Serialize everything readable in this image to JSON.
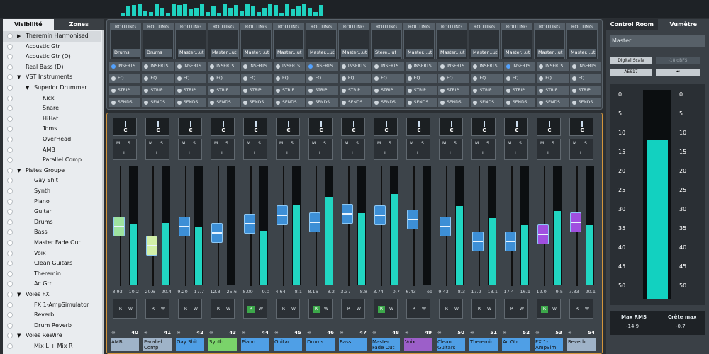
{
  "left_panel": {
    "tabs": [
      "Visibilité",
      "Zones"
    ],
    "tree": [
      {
        "label": "Theremin Harmonised",
        "level": 0,
        "expand": "right",
        "selected": true
      },
      {
        "label": "Acoustic Gtr",
        "level": 0
      },
      {
        "label": "Acoustic Gtr (D)",
        "level": 0
      },
      {
        "label": "Real Bass (D)",
        "level": 0
      },
      {
        "label": "VST Instruments",
        "level": 0,
        "expand": "down"
      },
      {
        "label": "Superior Drummer",
        "level": 1,
        "expand": "down"
      },
      {
        "label": "Kick",
        "level": 2
      },
      {
        "label": "Snare",
        "level": 2
      },
      {
        "label": "HiHat",
        "level": 2
      },
      {
        "label": "Toms",
        "level": 2
      },
      {
        "label": "OverHead",
        "level": 2
      },
      {
        "label": "AMB",
        "level": 2
      },
      {
        "label": "Parallel Comp",
        "level": 2
      },
      {
        "label": "Pistes Groupe",
        "level": 0,
        "expand": "down"
      },
      {
        "label": "Gay Shit",
        "level": 1
      },
      {
        "label": "Synth",
        "level": 1
      },
      {
        "label": "Piano",
        "level": 1
      },
      {
        "label": "Guitar",
        "level": 1
      },
      {
        "label": "Drums",
        "level": 1
      },
      {
        "label": "Bass",
        "level": 1
      },
      {
        "label": "Master Fade Out",
        "level": 1
      },
      {
        "label": "Voix",
        "level": 1
      },
      {
        "label": "Clean Guitars",
        "level": 1
      },
      {
        "label": "Theremin",
        "level": 1
      },
      {
        "label": "Ac Gtr",
        "level": 1
      },
      {
        "label": "Voies FX",
        "level": 0,
        "expand": "down"
      },
      {
        "label": "FX 1-AmpSimulator",
        "level": 1
      },
      {
        "label": "Reverb",
        "level": 1
      },
      {
        "label": "Drum Reverb",
        "level": 1
      },
      {
        "label": "Voies ReWire",
        "level": 0,
        "expand": "down"
      },
      {
        "label": "Mix L + Mix R",
        "level": 1
      }
    ]
  },
  "routing": {
    "header": "ROUTING",
    "outputs": [
      "Drums",
      "Drums",
      "Master...ut",
      "Master...ut",
      "Master...ut",
      "Master...ut",
      "Master...ut",
      "Master...ut",
      "Stere...ut",
      "Master...ut",
      "Master...ut",
      "Master...ut",
      "Master...ut",
      "Master...ut",
      "Master...ut"
    ],
    "section_labels": [
      "INSERTS",
      "EQ",
      "STRIP",
      "SENDS"
    ],
    "active_mask": {
      "INSERTS": [
        1,
        0,
        0,
        0,
        0,
        0,
        1,
        0,
        0,
        0,
        0,
        0,
        1,
        0,
        0
      ],
      "EQ": [
        0,
        0,
        0,
        0,
        0,
        0,
        0,
        0,
        0,
        0,
        0,
        0,
        0,
        0,
        0
      ],
      "STRIP": [
        0,
        0,
        0,
        0,
        0,
        0,
        0,
        0,
        0,
        0,
        0,
        0,
        0,
        0,
        0
      ],
      "SENDS": [
        0,
        0,
        0,
        0,
        0,
        0,
        0,
        0,
        0,
        0,
        0,
        0,
        0,
        0,
        0
      ]
    }
  },
  "channels": [
    {
      "num": "40",
      "name": "AMB",
      "color": "#9fb3c8",
      "fader_db": "-8.93",
      "meter_db": "-10.2",
      "fader": 0.52,
      "meter": 0.51,
      "cap": "#9ee3a0",
      "rw": "none"
    },
    {
      "num": "41",
      "name": "Parallel Comp",
      "color": "#9fb3c8",
      "fader_db": "-20.6",
      "meter_db": "-20.4",
      "fader": 0.34,
      "meter": 0.52,
      "cap": "#d2f0a8",
      "rw": "none"
    },
    {
      "num": "42",
      "name": "Gay Shit",
      "color": "#4f9fe6",
      "fader_db": "-9.20",
      "meter_db": "-17.7",
      "fader": 0.52,
      "meter": 0.48,
      "cap": "#3d8fd6",
      "rw": "none"
    },
    {
      "num": "43",
      "name": "Synth",
      "color": "#7ad36a",
      "fader_db": "-12.3",
      "meter_db": "-25.6",
      "fader": 0.46,
      "meter": 0.0,
      "cap": "#3d8fd6",
      "rw": "none"
    },
    {
      "num": "44",
      "name": "Piano",
      "color": "#4f9fe6",
      "fader_db": "-8.00",
      "meter_db": "-9.0",
      "fader": 0.55,
      "meter": 0.45,
      "cap": "#3d8fd6",
      "rw": "on"
    },
    {
      "num": "45",
      "name": "Guitar",
      "color": "#4f9fe6",
      "fader_db": "-4.64",
      "meter_db": "-8.1",
      "fader": 0.63,
      "meter": 0.67,
      "cap": "#3d8fd6",
      "rw": "none"
    },
    {
      "num": "46",
      "name": "Drums",
      "color": "#4f9fe6",
      "fader_db": "-8.16",
      "meter_db": "-8.2",
      "fader": 0.56,
      "meter": 0.74,
      "cap": "#3d8fd6",
      "rw": "on"
    },
    {
      "num": "47",
      "name": "Bass",
      "color": "#4f9fe6",
      "fader_db": "-3.37",
      "meter_db": "-8.8",
      "fader": 0.64,
      "meter": 0.6,
      "cap": "#3d8fd6",
      "rw": "none"
    },
    {
      "num": "48",
      "name": "Master Fade Out",
      "color": "#4f9fe6",
      "fader_db": "-3.74",
      "meter_db": "-0.7",
      "fader": 0.63,
      "meter": 0.76,
      "cap": "#3d8fd6",
      "rw": "on"
    },
    {
      "num": "49",
      "name": "Voix",
      "color": "#9c5fc9",
      "fader_db": "-6.43",
      "meter_db": "-oo",
      "fader": 0.59,
      "meter": 0.0,
      "cap": "#3d8fd6",
      "rw": "none"
    },
    {
      "num": "50",
      "name": "Clean Guitars",
      "color": "#4f9fe6",
      "fader_db": "-9.43",
      "meter_db": "-8.3",
      "fader": 0.52,
      "meter": 0.66,
      "cap": "#3d8fd6",
      "rw": "none"
    },
    {
      "num": "51",
      "name": "Theremin",
      "color": "#4f9fe6",
      "fader_db": "-17.9",
      "meter_db": "-13.1",
      "fader": 0.38,
      "meter": 0.56,
      "cap": "#3d8fd6",
      "rw": "none"
    },
    {
      "num": "52",
      "name": "Ac Gtr",
      "color": "#4f9fe6",
      "fader_db": "-17.4",
      "meter_db": "-16.1",
      "fader": 0.38,
      "meter": 0.5,
      "cap": "#3d8fd6",
      "rw": "none"
    },
    {
      "num": "53",
      "name": "FX 1-AmpSim",
      "color": "#4f9fe6",
      "fader_db": "-12.0",
      "meter_db": "-9.5",
      "fader": 0.45,
      "meter": 0.62,
      "cap": "#a04fe0",
      "rw": "on"
    },
    {
      "num": "54",
      "name": "Reverb",
      "color": "#9fb3c8",
      "fader_db": "-7.33",
      "meter_db": "-20.1",
      "fader": 0.56,
      "meter": 0.5,
      "cap": "#a04fe0",
      "rw": "none"
    }
  ],
  "right_panel": {
    "tabs": [
      "Control Room",
      "Vumètre"
    ],
    "master_label": "Master",
    "digital_scale": "Digital Scale",
    "dbfs": "-18 dBFS",
    "aes": "AES17",
    "reset_symbol": "⏮",
    "scale": [
      "0",
      "5",
      "10",
      "15",
      "20",
      "25",
      "30",
      "35",
      "40",
      "45",
      "50"
    ],
    "master_level": 0.76,
    "max_rms_label": "Max RMS",
    "max_rms_value": "-14.9",
    "crest_label": "Crête max",
    "crest_value": "-0.7"
  }
}
